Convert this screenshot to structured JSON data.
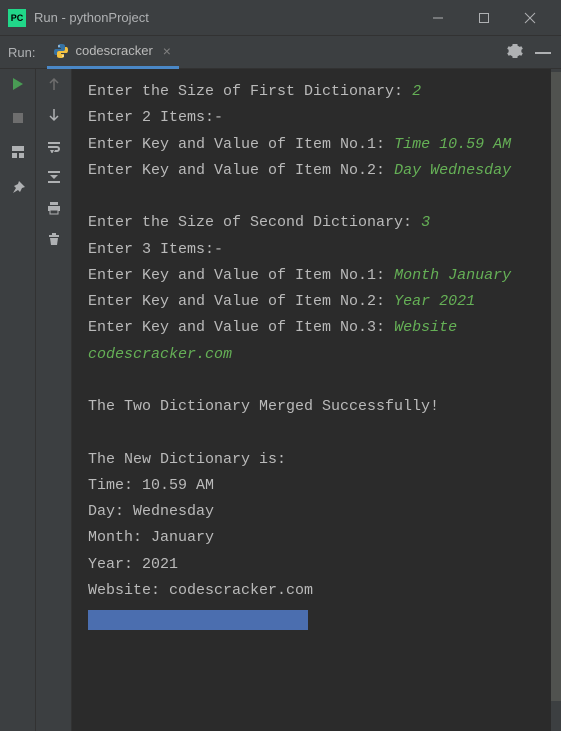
{
  "title_bar": {
    "icon_text": "PC",
    "title": "Run - pythonProject"
  },
  "tabs_row": {
    "run_label": "Run:",
    "tab_name": "codescracker",
    "close_glyph": "×"
  },
  "console": {
    "l1p": "Enter the Size of First Dictionary: ",
    "l1i": "2",
    "l2": "Enter 2 Items:-",
    "l3p": "Enter Key and Value of Item No.1: ",
    "l3i": "Time 10.59 AM",
    "l4p": "Enter Key and Value of Item No.2: ",
    "l4i": "Day Wednesday",
    "blank1": " ",
    "l5p": "Enter the Size of Second Dictionary: ",
    "l5i": "3",
    "l6": "Enter 3 Items:-",
    "l7p": "Enter Key and Value of Item No.1: ",
    "l7i": "Month January",
    "l8p": "Enter Key and Value of Item No.2: ",
    "l8i": "Year 2021",
    "l9p": "Enter Key and Value of Item No.3: ",
    "l9i": "Website codescracker.com",
    "blank2": " ",
    "l10": "The Two Dictionary Merged Successfully!",
    "blank3": " ",
    "l11": "The New Dictionary is:",
    "l12": "Time: 10.59 AM",
    "l13": "Day: Wednesday",
    "l14": "Month: January",
    "l15": "Year: 2021",
    "l16": "Website: codescracker.com"
  }
}
